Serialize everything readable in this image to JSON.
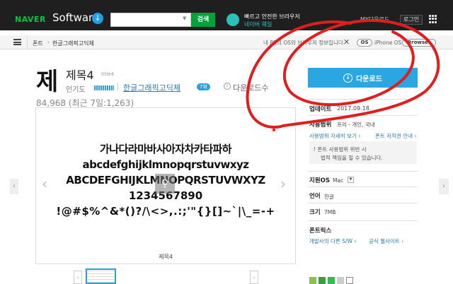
{
  "topbar": {
    "brand": "NAVER",
    "product": "Software",
    "search_button": "검색",
    "promo_line1": "빠르고 안전한 브라우저",
    "promo_line2": "네이버 웨일",
    "my_font": "MY다운로드",
    "login": "로그인"
  },
  "breadcrumb": {
    "root": "폰트",
    "current": "한글그래픽고딕체",
    "os_notice": "내 PC의 OS와 브라우저 정보입니다.",
    "os_tag": "OS",
    "os_value": "iPhone OS",
    "browser_tag": "Browser"
  },
  "font": {
    "glyph": "제",
    "title": "제목4",
    "subtitle": "title4",
    "popularity_label": "인기도",
    "family_link": "한글그래픽고딕체",
    "rank_badge": "7위",
    "download_count_label": "다운로드수",
    "download_count_value": "84,968 (최근 7일:1,263)"
  },
  "preview": {
    "line1": "가나다라마바사아자차카타파하",
    "line2": "abcdefghijklmnopqrstuvwxyz",
    "line3": "ABCDEFGHIJKLMNOPQRSTUVWXYZ",
    "line4": "1234567890",
    "line5": "!@#$%^&*()?/\\<>,.:;'\"{}[]~`|\\_=-+",
    "caption": "제목4"
  },
  "panel": {
    "download_button": "다운로드",
    "update_label": "업데이트",
    "update_value": "2017.09.18.",
    "usage_label": "사용범위",
    "usage_value": "프리 - 개인, 국내",
    "usage_more": "사용범위 자세히 보기 ›",
    "usage_guide": "폰트 저작권 안내 ›",
    "notice_line1": "! 폰트 사용범위 위반 시",
    "notice_line2": "법적 책임을 질 수 있습니다.",
    "os_label": "지원OS",
    "os_value": "Mac",
    "lang_label": "언어",
    "lang_value": "한글",
    "size_label": "크기",
    "size_value": "7MB",
    "trademark_label": "폰트릭스",
    "trademark_link1": "개발사의 다른 S/W ›",
    "trademark_link2": "공식 웹사이트 ›"
  },
  "colors": {
    "accent": "#2aa6e0",
    "naver_green": "#03a23b",
    "annotation_red": "#e01e1e"
  },
  "icons": [
    "menu-icon",
    "download-icon",
    "close-icon",
    "zoom-icon",
    "apps-icon",
    "chevron-left-icon",
    "chevron-right-icon"
  ]
}
